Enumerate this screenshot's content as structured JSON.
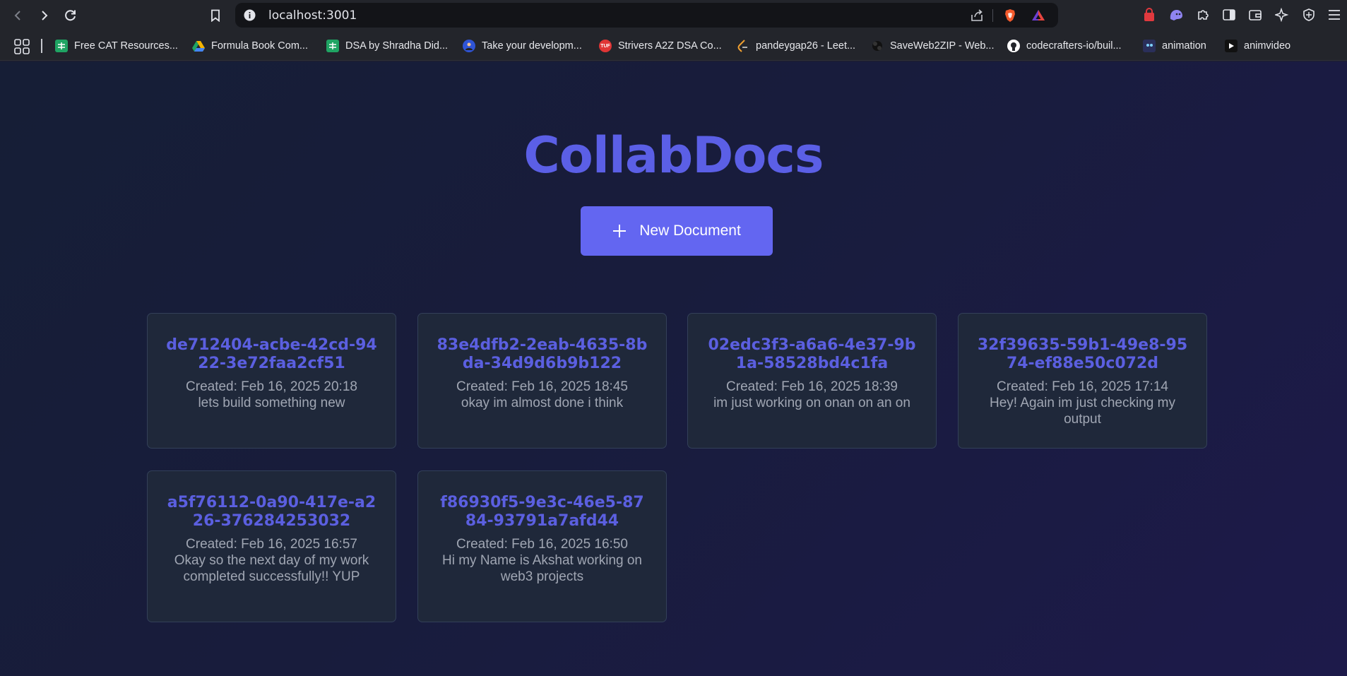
{
  "browser": {
    "url": "localhost:3001",
    "bookmarks": [
      {
        "label": "Free CAT Resources...",
        "icon": "sheets-icon",
        "color": "#1fa463"
      },
      {
        "label": "Formula Book Com...",
        "icon": "drive-icon",
        "color": "#f4b400"
      },
      {
        "label": "DSA by Shradha Did...",
        "icon": "sheets-icon",
        "color": "#1fa463"
      },
      {
        "label": "Take your developm...",
        "icon": "avatar-icon",
        "color": "#2f54d6"
      },
      {
        "label": "Strivers A2Z DSA Co...",
        "icon": "tuf-icon",
        "color": "#e03535"
      },
      {
        "label": "pandeygap26 - Leet...",
        "icon": "leetcode-icon",
        "color": "#f0a030"
      },
      {
        "label": "SaveWeb2ZIP - Web...",
        "icon": "saveweb-icon",
        "color": "#111111"
      },
      {
        "label": "codecrafters-io/buil...",
        "icon": "github-icon",
        "color": "#ffffff"
      },
      {
        "label": "animation",
        "icon": "animation-icon",
        "color": "#2a2f5a"
      },
      {
        "label": "animvideo",
        "icon": "video-icon",
        "color": "#111111"
      }
    ]
  },
  "app": {
    "title": "CollabDocs",
    "new_doc_label": "New Document",
    "accent": "#6366f1"
  },
  "documents": [
    {
      "id": "de712404-acbe-42cd-9422-3e72faa2cf51",
      "created": "Created: Feb 16, 2025 20:18",
      "content": "lets build something new"
    },
    {
      "id": "83e4dfb2-2eab-4635-8bda-34d9d6b9b122",
      "created": "Created: Feb 16, 2025 18:45",
      "content": "okay im almost done i think"
    },
    {
      "id": "02edc3f3-a6a6-4e37-9b1a-58528bd4c1fa",
      "created": "Created: Feb 16, 2025 18:39",
      "content": "im just working on onan on an on"
    },
    {
      "id": "32f39635-59b1-49e8-9574-ef88e50c072d",
      "created": "Created: Feb 16, 2025 17:14",
      "content": "Hey! Again im just checking my output"
    },
    {
      "id": "a5f76112-0a90-417e-a226-376284253032",
      "created": "Created: Feb 16, 2025 16:57",
      "content": "Okay so the next day of my work completed successfully!! YUP"
    },
    {
      "id": "f86930f5-9e3c-46e5-8784-93791a7afd44",
      "created": "Created: Feb 16, 2025 16:50",
      "content": "Hi my Name is Akshat working on web3 projects"
    }
  ]
}
